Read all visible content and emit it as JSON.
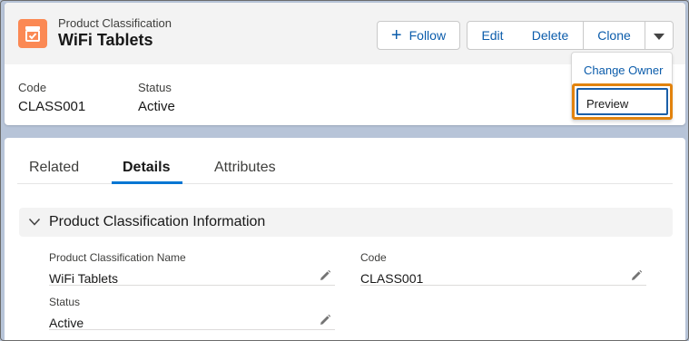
{
  "header": {
    "object_type": "Product Classification",
    "record_name": "WiFi Tablets",
    "icon": "product-classification-icon",
    "accent_color": "#fb8954"
  },
  "actions": {
    "follow_label": "Follow",
    "edit_label": "Edit",
    "delete_label": "Delete",
    "clone_label": "Clone"
  },
  "highlights": [
    {
      "label": "Code",
      "value": "CLASS001"
    },
    {
      "label": "Status",
      "value": "Active"
    }
  ],
  "dropdown": {
    "items": [
      "Change Owner",
      "Preview"
    ],
    "highlighted": "Preview"
  },
  "tabs": [
    {
      "label": "Related"
    },
    {
      "label": "Details",
      "active": true
    },
    {
      "label": "Attributes"
    }
  ],
  "section": {
    "title": "Product Classification Information",
    "fields": [
      {
        "label": "Product Classification Name",
        "value": "WiFi Tablets"
      },
      {
        "label": "Code",
        "value": "CLASS001"
      },
      {
        "label": "Status",
        "value": "Active"
      }
    ]
  }
}
